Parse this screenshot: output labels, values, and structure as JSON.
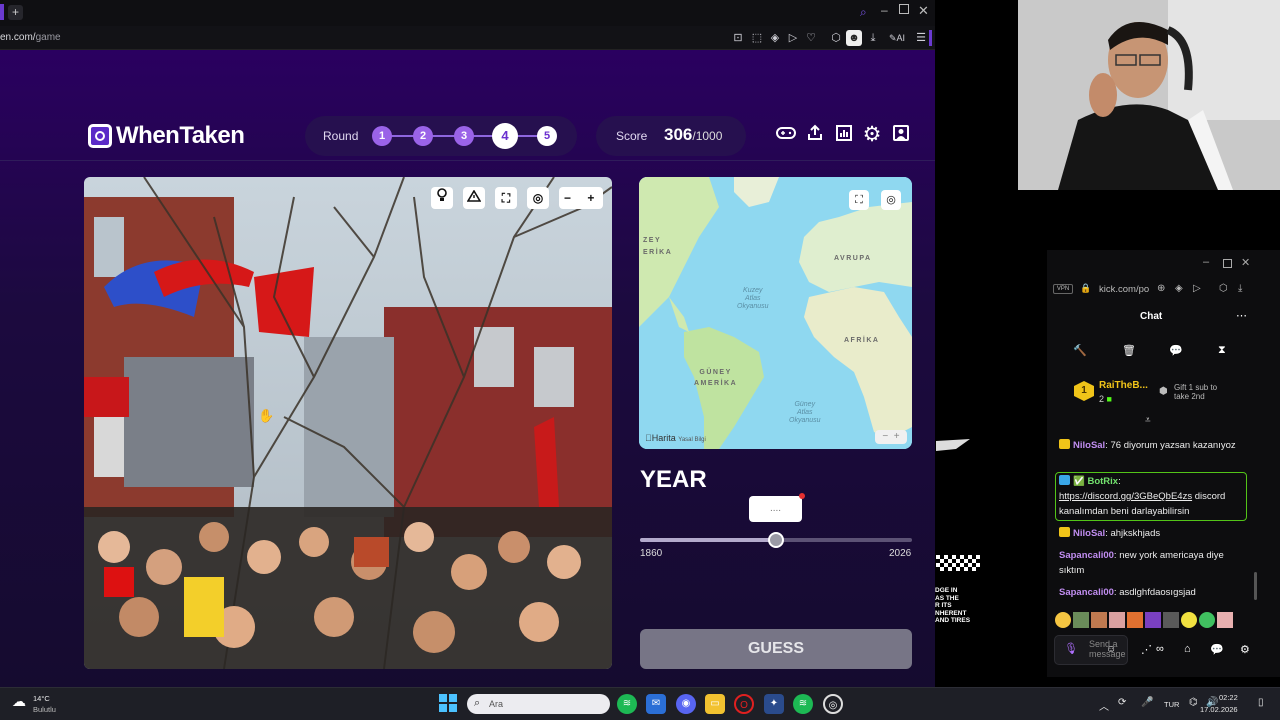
{
  "browser": {
    "url_prefix": "en.com/",
    "url_path": "game",
    "toolbar_ai_label": "AI"
  },
  "game": {
    "brand": "WhenTaken",
    "round_label": "Round",
    "rounds": [
      {
        "n": "1",
        "state": "done"
      },
      {
        "n": "2",
        "state": "done"
      },
      {
        "n": "3",
        "state": "done"
      },
      {
        "n": "4",
        "state": "active"
      },
      {
        "n": "5",
        "state": "future"
      }
    ],
    "score_label": "Score",
    "score_value": "306",
    "score_max": "/1000",
    "header_icons": [
      "gamepad-icon",
      "share-icon",
      "stats-icon",
      "settings-icon",
      "profile-icon"
    ],
    "photo_tools": [
      "hint-icon",
      "report-icon",
      "fullscreen-icon",
      "focus-icon",
      "zoom-out-icon",
      "zoom-in-icon"
    ]
  },
  "map": {
    "labels": {
      "north_america": "ZEY\nERİKA",
      "europe": "AVRUPA",
      "africa": "AFRİKA",
      "south_america": "GÜNEY\nAMERİKA",
      "north_atlantic": "Kuzey\nAtlas\nOkyanusu",
      "south_atlantic": "Güney\nAtlas\nOkyanusu"
    },
    "attribution": "Harita",
    "legal": "Yasal Bilgi"
  },
  "year": {
    "title": "YEAR",
    "value_placeholder": "....",
    "min": "1860",
    "max": "2026",
    "slider_fraction": 0.5
  },
  "guess_label": "GUESS",
  "chat": {
    "title": "Chat",
    "browser_url": "kick.com/po",
    "vpn_label": "VPN",
    "top_gifter": "RaiTheB...",
    "top_gifter_count": "2",
    "rank": "1",
    "gift_text": "Gift 1 sub to\ntake 2nd",
    "messages": [
      {
        "user": "NiloSal",
        "text": ": 76 diyorum yazsan kazanıyoz",
        "kind": "sub"
      },
      {
        "user": "BotRix",
        "text": ":",
        "link": "https://discord.gg/3GBeQbE4zs",
        "tail": " discord kanalımdan beni darlayabilirsin",
        "kind": "bot"
      },
      {
        "user": "NiloSal",
        "text": ": ahjkskhjads",
        "kind": "sub"
      },
      {
        "user": "Sapancali00",
        "text": ": new york americaya diye sıktım",
        "kind": "plain"
      },
      {
        "user": "Sapancali00",
        "text": ": asdlghfdaosıgsjad",
        "kind": "plain"
      }
    ],
    "input_placeholder": "Send a message"
  },
  "overlay_text": "DGE IN\nAS THE\nR ITS\nNHERENT\nAND TIRES",
  "taskbar": {
    "weather_temp": "14°C",
    "weather_desc": "Bulutlu",
    "search_placeholder": "Ara",
    "lang": "TUR",
    "time": "02:22",
    "date": "17.02.2026"
  }
}
